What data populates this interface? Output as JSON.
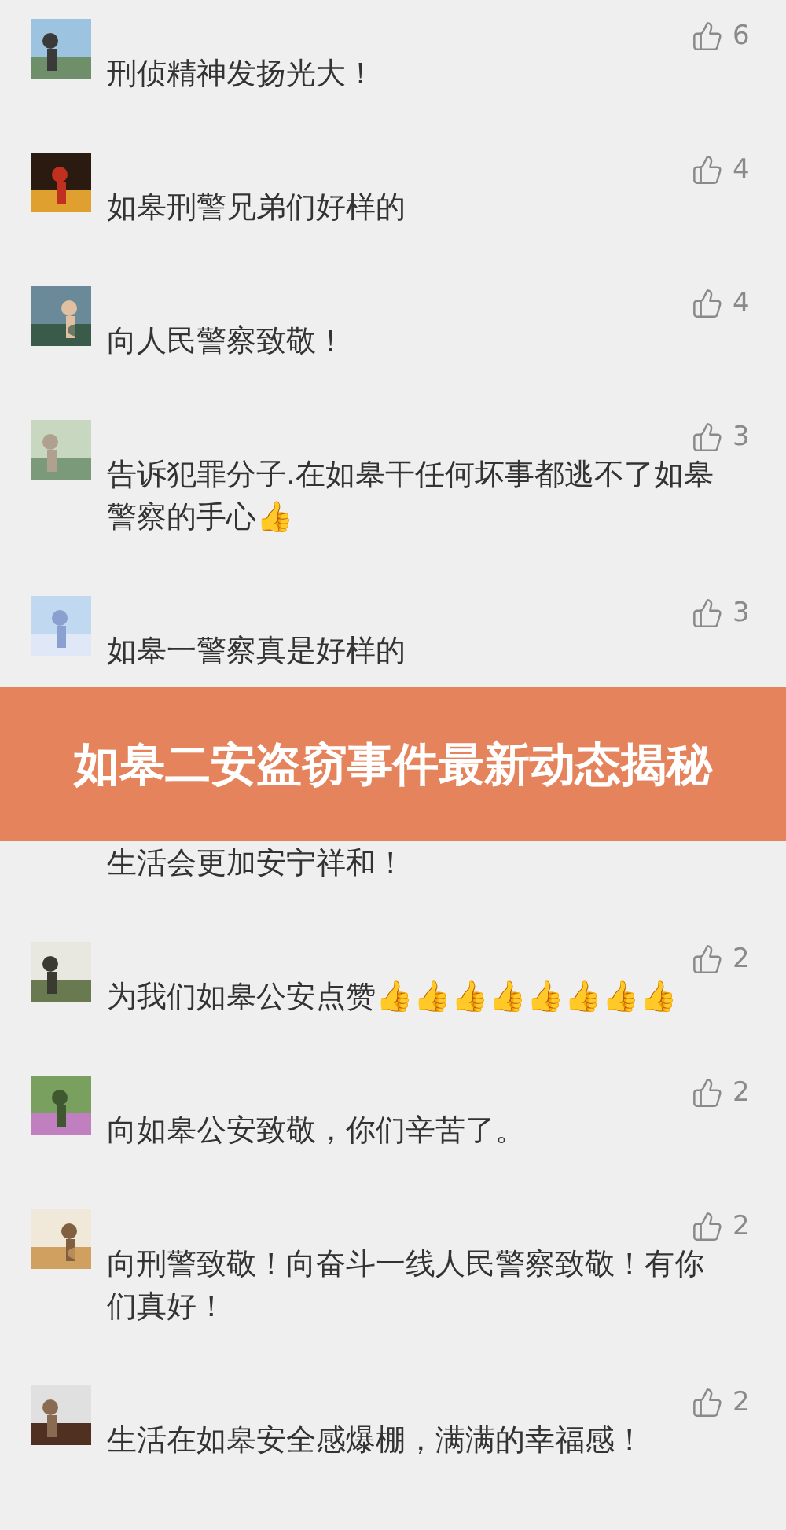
{
  "comments": [
    {
      "likes": "6",
      "text": "刑侦精神发扬光大！"
    },
    {
      "likes": "4",
      "text": "如皋刑警兄弟们好样的"
    },
    {
      "likes": "4",
      "text": "向人民警察致敬！"
    },
    {
      "likes": "3",
      "text": "告诉犯罪分子.在如皋干任何坏事都逃不了如皋警察的手心👍"
    },
    {
      "likes": "3",
      "text": "如皋一警察真是好样的"
    },
    {
      "kind": "partial",
      "text": "生活会更加安宁祥和！"
    },
    {
      "likes": "2",
      "text": "为我们如皋公安点赞👍👍👍👍👍👍👍👍"
    },
    {
      "likes": "2",
      "text": "向如皋公安致敬，你们辛苦了。"
    },
    {
      "likes": "2",
      "text": "向刑警致敬！向奋斗一线人民警察致敬！有你们真好！"
    },
    {
      "likes": "2",
      "text": "生活在如皋安全感爆棚，满满的幸福感！"
    }
  ],
  "banner": {
    "title": "如皋二安盗窃事件最新动态揭秘"
  }
}
